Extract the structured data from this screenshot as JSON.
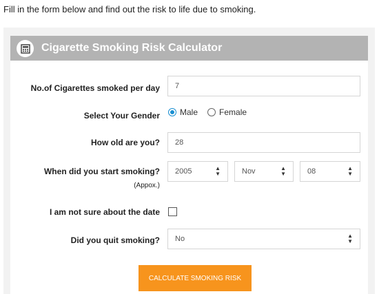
{
  "intro_text": "Fill in the form below and find out the risk to life due to smoking.",
  "calculator": {
    "title": "Cigarette Smoking Risk Calculator",
    "icon": "calculator-icon",
    "accent_color": "#f7941d",
    "header_color": "#b3b3b3",
    "radio_color": "#1a8fd1"
  },
  "form": {
    "cigarettes": {
      "label": "No.of Cigarettes smoked per day",
      "value": "7"
    },
    "gender": {
      "label": "Select Your Gender",
      "options": [
        "Male",
        "Female"
      ],
      "selected": "Male"
    },
    "age": {
      "label": "How old are you?",
      "value": "28"
    },
    "start": {
      "label": "When did you start smoking?",
      "sublabel": "(Appox.)",
      "year": "2005",
      "month": "Nov",
      "day": "08"
    },
    "not_sure": {
      "label": "I am not sure about the date",
      "checked": false
    },
    "quit": {
      "label": "Did you quit smoking?",
      "value": "No"
    }
  },
  "submit_label": "CALCULATE SMOKING RISK"
}
